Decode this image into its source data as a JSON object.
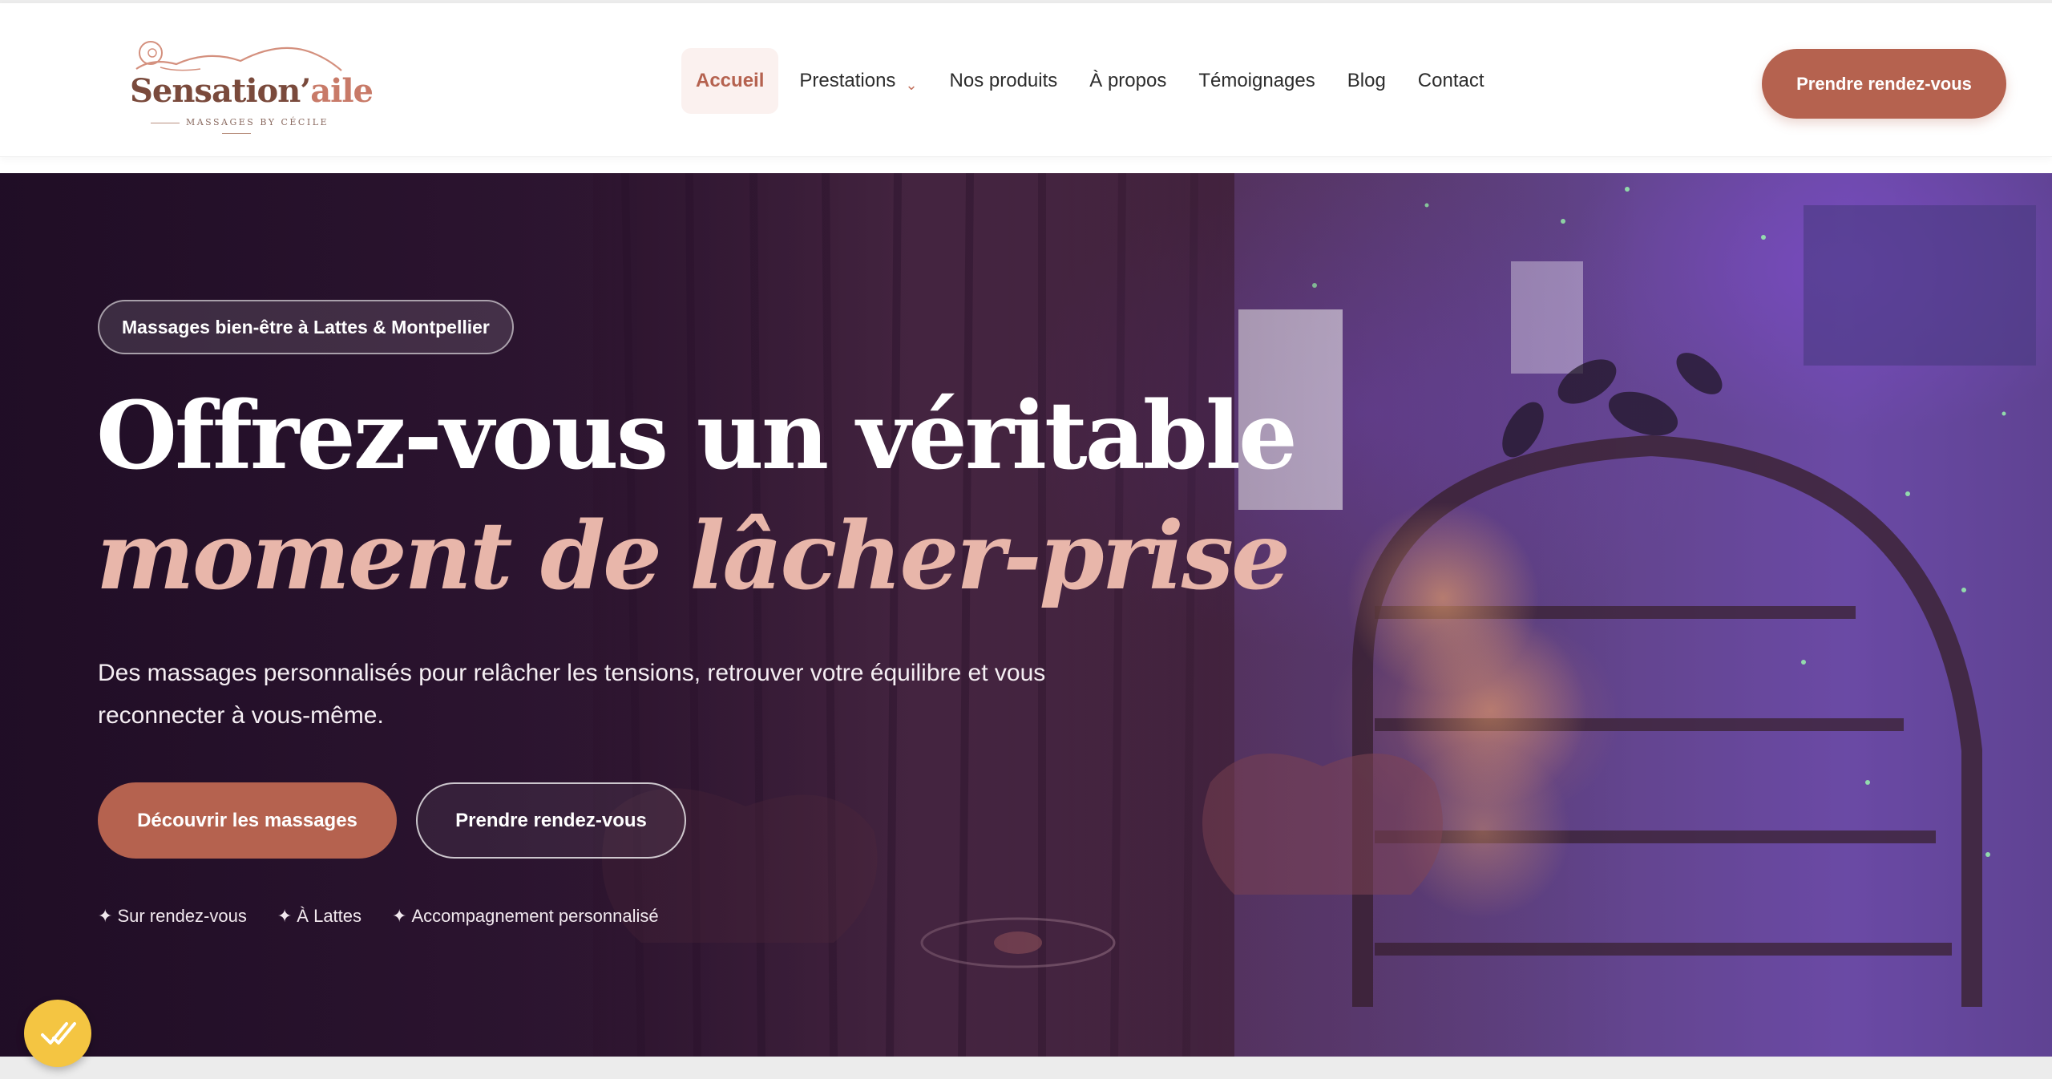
{
  "brand": {
    "name_part1": "Sensation’",
    "name_part2": "aile",
    "tagline": "MASSAGES BY CÉCILE"
  },
  "nav": {
    "items": [
      {
        "label": "Accueil",
        "active": true
      },
      {
        "label": "Prestations",
        "dropdown": true
      },
      {
        "label": "Nos produits"
      },
      {
        "label": "À propos"
      },
      {
        "label": "Témoignages"
      },
      {
        "label": "Blog"
      },
      {
        "label": "Contact"
      }
    ],
    "cta": "Prendre rendez-vous"
  },
  "hero": {
    "pill": "Massages bien-être à Lattes & Montpellier",
    "title_line1": "Offrez-vous un véritable",
    "title_line2": "moment de lâcher-prise",
    "lead": "Des massages personnalisés pour relâcher les tensions, retrouver votre équilibre et vous reconnecter à vous-même.",
    "primary_button": "Découvrir les massages",
    "secondary_button": "Prendre rendez-vous",
    "features": [
      {
        "star": "✦",
        "label": "Sur rendez-vous"
      },
      {
        "star": "✦",
        "label": "À Lattes"
      },
      {
        "star": "✦",
        "label": "Accompagnement personnalisé"
      }
    ]
  },
  "colors": {
    "accent": "#b5624f",
    "accent_light": "#e8b6aa",
    "badge": "#f4c542"
  },
  "icons": {
    "dropdown": "chevron-down-icon",
    "badge": "double-check-icon",
    "logo": "massage-silhouette-icon"
  }
}
